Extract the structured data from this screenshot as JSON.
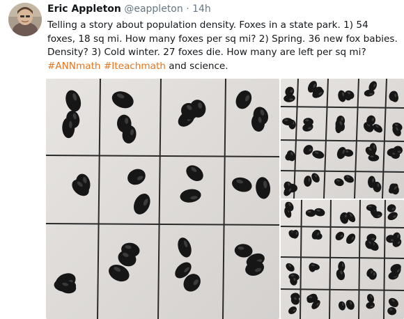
{
  "tweet": {
    "author_name": "Eric Appleton",
    "author_handle": "@eappleton",
    "separator": "·",
    "timestamp": "14h",
    "text_plain": "Telling a story about population density. Foxes in a state park. 1) 54 foxes, 18 sq mi. How many foxes per sq mi? 2) Spring. 36 new fox babies. Density? 3) Cold winter. 27 foxes die. How many are left per sq mi?",
    "hashtag_1": "#ANNmath",
    "hashtag_2": "#Iteachmath",
    "text_tail_and": "and",
    "text_tail_end": "science.",
    "hashtag_color": "#e0761f"
  },
  "media": {
    "photo_count": 3,
    "icons": [
      "avatar-icon"
    ]
  }
}
